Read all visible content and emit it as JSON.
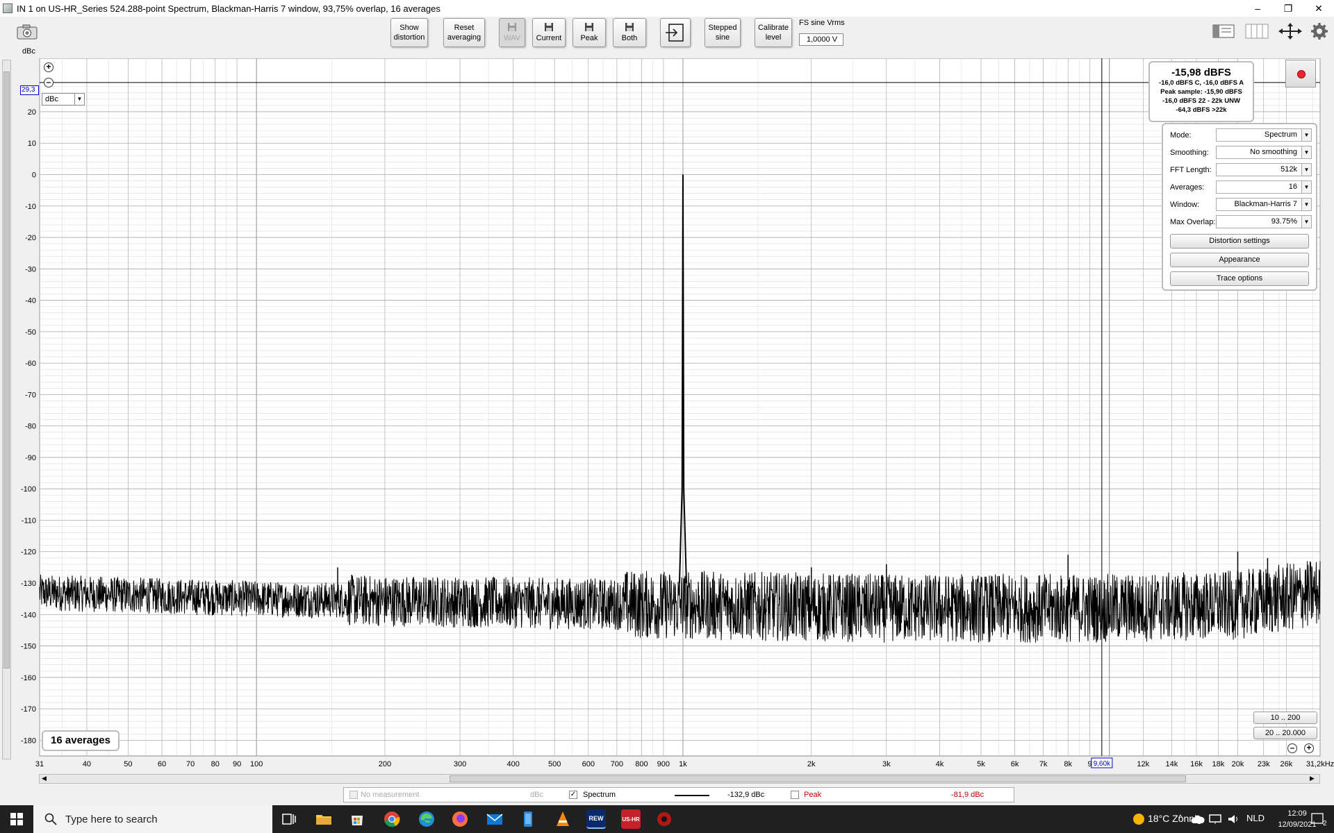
{
  "window": {
    "title": "IN 1 on US-HR_Series 524.288-point Spectrum, Blackman-Harris 7 window, 93,75% overlap, 16 averages",
    "minimize_glyph": "–",
    "maximize_glyph": "❐",
    "close_glyph": "✕"
  },
  "toolbar": {
    "show_distortion": [
      "Show",
      "distortion"
    ],
    "reset_averaging": [
      "Reset",
      "averaging"
    ],
    "wav": "WAV",
    "current": "Current",
    "peak": "Peak",
    "both": "Both",
    "stepped_sine": [
      "Stepped",
      "sine"
    ],
    "calibrate_level": [
      "Calibrate",
      "level"
    ],
    "fs_label": "FS sine Vrms",
    "fs_value": "1,0000 V"
  },
  "graph": {
    "y_unit": "dBc",
    "unit_select": "dBc",
    "cursor_y_value": "29,3",
    "cursor_x_value": "9,60k"
  },
  "level": {
    "main": "-15,98 dBFS",
    "line1": "-16,0 dBFS C, -16,0 dBFS A",
    "line2": "Peak sample: -15,90 dBFS",
    "line3": "-16,0 dBFS 22 - 22k UNW",
    "line4": "-64,3 dBFS >22k"
  },
  "controls": {
    "mode_label": "Mode:",
    "mode_value": "Spectrum",
    "smoothing_label": "Smoothing:",
    "smoothing_value": "No  smoothing",
    "fft_label": "FFT Length:",
    "fft_value": "512k",
    "averages_label": "Averages:",
    "averages_value": "16",
    "window_label": "Window:",
    "window_value": "Blackman-Harris 7",
    "overlap_label": "Max Overlap:",
    "overlap_value": "93.75%",
    "distortion_settings": "Distortion settings",
    "appearance": "Appearance",
    "trace_options": "Trace options"
  },
  "badge": {
    "averages": "16 averages"
  },
  "range_buttons": {
    "r1": "10 .. 200",
    "r2": "20 .. 20.000"
  },
  "legend": {
    "no_measurement": "No measurement",
    "no_measurement_unit": "dBc",
    "spectrum": "Spectrum",
    "spectrum_value": "-132,9 dBc",
    "peak": "Peak",
    "peak_value": "-81,9 dBc"
  },
  "taskbar": {
    "search_placeholder": "Type here to search",
    "weather": "18°C  Zonnig",
    "lang": "NLD",
    "time": "12:09",
    "date": "12/09/2021",
    "notif_count": "2",
    "rew_label": "REW",
    "ushr_label": "US-HR"
  },
  "colors": {
    "trace": "#000000",
    "grid_major": "#a8a8a8",
    "grid_minor": "#dcdcdc",
    "cursor": "#000000",
    "peak_text": "#c00000"
  },
  "chart_data": {
    "type": "line",
    "title": "",
    "xlabel": "",
    "ylabel": "dBc",
    "x_scale": "log",
    "xlim": [
      31,
      31200
    ],
    "ylim": [
      -185,
      37
    ],
    "grid": true,
    "x_ticks": [
      {
        "v": 31,
        "t": "31"
      },
      {
        "v": 40,
        "t": "40"
      },
      {
        "v": 50,
        "t": "50"
      },
      {
        "v": 60,
        "t": "60"
      },
      {
        "v": 70,
        "t": "70"
      },
      {
        "v": 80,
        "t": "80"
      },
      {
        "v": 90,
        "t": "90"
      },
      {
        "v": 100,
        "t": "100"
      },
      {
        "v": 200,
        "t": "200"
      },
      {
        "v": 300,
        "t": "300"
      },
      {
        "v": 400,
        "t": "400"
      },
      {
        "v": 500,
        "t": "500"
      },
      {
        "v": 600,
        "t": "600"
      },
      {
        "v": 700,
        "t": "700"
      },
      {
        "v": 800,
        "t": "800"
      },
      {
        "v": 900,
        "t": "900"
      },
      {
        "v": 1000,
        "t": "1k"
      },
      {
        "v": 2000,
        "t": "2k"
      },
      {
        "v": 3000,
        "t": "3k"
      },
      {
        "v": 4000,
        "t": "4k"
      },
      {
        "v": 5000,
        "t": "5k"
      },
      {
        "v": 6000,
        "t": "6k"
      },
      {
        "v": 7000,
        "t": "7k"
      },
      {
        "v": 8000,
        "t": "8k"
      },
      {
        "v": 9000,
        "t": "9"
      },
      {
        "v": 12000,
        "t": "12k"
      },
      {
        "v": 14000,
        "t": "14k"
      },
      {
        "v": 16000,
        "t": "16k"
      },
      {
        "v": 18000,
        "t": "18k"
      },
      {
        "v": 20000,
        "t": "20k"
      },
      {
        "v": 23000,
        "t": "23k"
      },
      {
        "v": 26000,
        "t": "26k"
      },
      {
        "v": 31200,
        "t": "31,2kHz"
      }
    ],
    "y_ticks": [
      20,
      10,
      0,
      -10,
      -20,
      -30,
      -40,
      -50,
      -60,
      -70,
      -80,
      -90,
      -100,
      -110,
      -120,
      -130,
      -140,
      -150,
      -160,
      -170,
      -180
    ],
    "cursor": {
      "x": 9600,
      "y": 29.3
    },
    "series": [
      {
        "name": "Spectrum",
        "fundamental": {
          "x": 1000,
          "y": 0
        },
        "harmonics": [
          {
            "x": 2000,
            "y": -125
          },
          {
            "x": 3000,
            "y": -124
          },
          {
            "x": 8000,
            "y": -121
          },
          {
            "x": 20000,
            "y": -120
          },
          {
            "x": 23500,
            "y": -122
          },
          {
            "x": 155,
            "y": -125
          }
        ],
        "noise_floor": [
          {
            "x": 31,
            "y": -133
          },
          {
            "x": 100,
            "y": -135
          },
          {
            "x": 300,
            "y": -136
          },
          {
            "x": 1000,
            "y": -137
          },
          {
            "x": 3000,
            "y": -138
          },
          {
            "x": 10000,
            "y": -138
          },
          {
            "x": 20000,
            "y": -137
          },
          {
            "x": 31200,
            "y": -133
          }
        ]
      }
    ]
  }
}
